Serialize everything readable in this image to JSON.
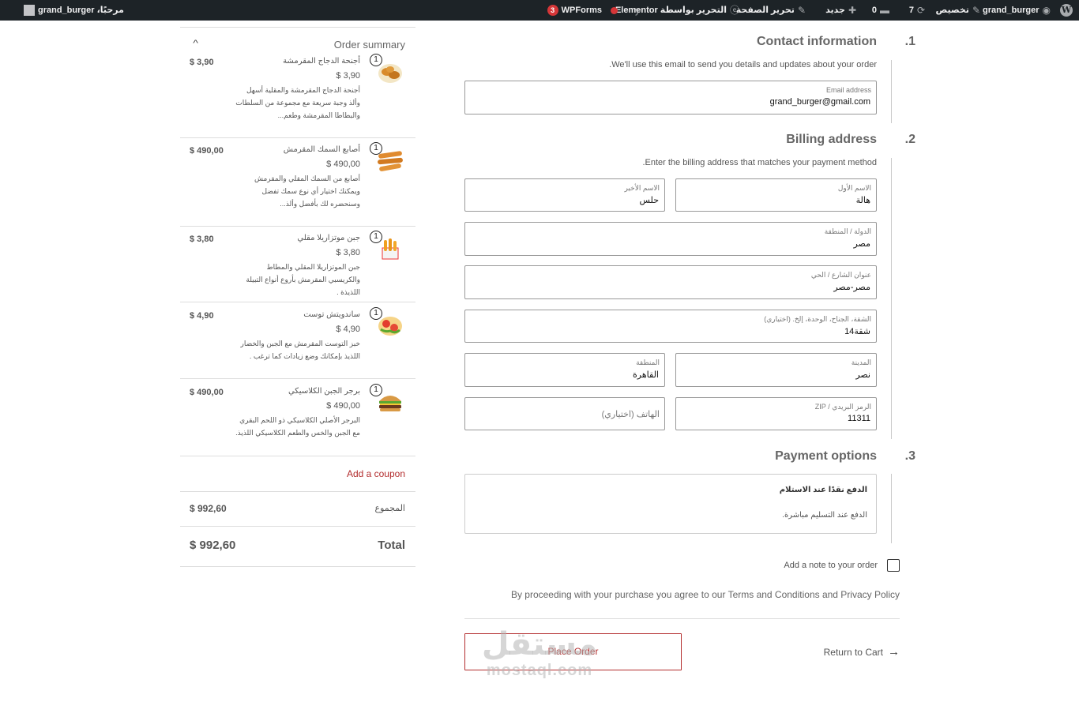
{
  "adminbar": {
    "site_name": "grand_burger",
    "customize": "تخصيص",
    "updates_count": "7",
    "comments_count": "0",
    "new_label": "جديد",
    "edit_page": "تحرير الصفحة",
    "edit_elementor": "التحرير بواسطة Elementor",
    "wpforms_label": "WPForms",
    "wpforms_badge": "3",
    "howdy": "مرحبًا، grand_burger"
  },
  "summary": {
    "title": "Order summary",
    "items": [
      {
        "qty": "1",
        "name": "أجنحة الدجاج المقرمشة",
        "unit_price": "$ 3,90",
        "total": "$ 3,90",
        "desc": "أجنحة الدجاج المقرمشة والمقلية أسهل وألذ وجبة سريعة مع مجموعة من السلطات والبطاطا المقرمشة وطعم..."
      },
      {
        "qty": "1",
        "name": "أصابع السمك المقرمش",
        "unit_price": "$ 490,00",
        "total": "$ 490,00",
        "desc": "أصابع من السمك المقلي والمقرمش ويمكنك اختيار أي نوع سمك تفضل وسنحضره لك بأفضل وألذ..."
      },
      {
        "qty": "1",
        "name": "جبن موتزاريلا مقلي",
        "unit_price": "$ 3,80",
        "total": "$ 3,80",
        "desc": "جبن الموتزاريلا المقلي والمطاط والكريسبي المقرمش بأروع أنواع التبيلة اللذيذة ."
      },
      {
        "qty": "1",
        "name": "ساندويتش توست",
        "unit_price": "$ 4,90",
        "total": "$ 4,90",
        "desc": "خبز التوست المقرمش مع الجبن والخضار اللذيذ بإمكانك وضع زيادات كما ترغب ."
      },
      {
        "qty": "1",
        "name": "برجر الجبن الكلاسيكي",
        "unit_price": "$ 490,00",
        "total": "$ 490,00",
        "desc": "البرجر الأصلي الكلاسيكي ذو اللحم البقري مع الجبن والخس والطعم الكلاسيكي اللذيذ."
      }
    ],
    "coupon_label": "Add a coupon",
    "subtotal_label": "المجموع",
    "subtotal_value": "$ 992,60",
    "total_label": "Total",
    "total_value": "$ 992,60"
  },
  "contact": {
    "number": ".1",
    "heading": "Contact information",
    "desc": ".We'll use this email to send you details and updates about your order",
    "email_label": "Email address",
    "email_value": "grand_burger@gmail.com"
  },
  "billing": {
    "number": ".2",
    "heading": "Billing address",
    "desc": ".Enter the billing address that matches your payment method",
    "first_name_label": "الاسم الأول",
    "first_name_value": "هالة",
    "last_name_label": "الاسم الأخير",
    "last_name_value": "حلس",
    "country_label": "الدولة / المنطقة",
    "country_value": "مصر",
    "street_label": "عنوان الشارع / الحي",
    "street_value": "مصر-مصر",
    "apt_label": "الشقة، الجناح، الوحدة، إلخ. (اختياري)",
    "apt_value": "شقة14",
    "city_label": "المدينة",
    "city_value": "نصر",
    "region_label": "المنطقة",
    "region_value": "القاهرة",
    "zip_label": "الرمز البريدي / ZIP",
    "zip_value": "11311",
    "phone_placeholder": "الهاتف (اختياري)"
  },
  "payment": {
    "number": ".3",
    "heading": "Payment options",
    "method_title": "الدفع نقدًا عند الاستلام",
    "method_desc": "الدفع عند التسليم مباشرة."
  },
  "note_label": "Add a note to your order",
  "terms_text": "By proceeding with your purchase you agree to our Terms and Conditions and Privacy Policy",
  "place_order_label": "Place Order",
  "return_label": "Return to Cart",
  "watermark": {
    "ar": "مستقل",
    "en": "mostaql.com"
  },
  "colors": {
    "accent": "#b32d2e",
    "adminbar": "#1d2327"
  }
}
